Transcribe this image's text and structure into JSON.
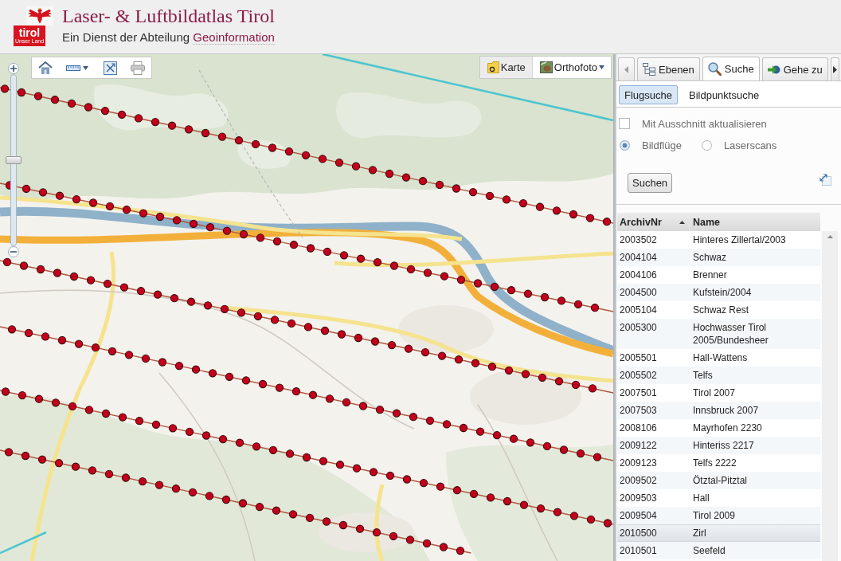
{
  "header": {
    "logo": {
      "wordmark": "tirol",
      "tagline": "Unser Land"
    },
    "title": "Laser- & Luftbildatlas Tirol",
    "subtitle": "Ein Dienst der Abteilung",
    "subtitle_link": "Geoinformation"
  },
  "map": {
    "zoom_slider": {
      "level": 0.5
    },
    "basemaps": [
      {
        "label": "Karte",
        "selected": true,
        "has_menu": false
      },
      {
        "label": "Orthofoto",
        "selected": false,
        "has_menu": true
      }
    ]
  },
  "panel": {
    "tabs": [
      {
        "label": "Ebenen",
        "selected": false
      },
      {
        "label": "Suche",
        "selected": true
      },
      {
        "label": "Gehe zu",
        "selected": false
      }
    ],
    "subtabs": [
      {
        "label": "Flugsuche",
        "selected": true
      },
      {
        "label": "Bildpunktsuche",
        "selected": false
      }
    ],
    "update_with_extent": {
      "label": "Mit Ausschnitt aktualisieren",
      "checked": false
    },
    "source_options": [
      {
        "label": "Bildflüge",
        "selected": true
      },
      {
        "label": "Laserscans",
        "selected": false
      }
    ],
    "search_button": "Suchen",
    "table": {
      "columns": [
        {
          "label": "ArchivNr",
          "sorted": true
        },
        {
          "label": "Name",
          "sorted": false
        }
      ],
      "rows": [
        {
          "archiv_nr": "2003502",
          "name": "Hinteres Zillertal/2003",
          "selected": false
        },
        {
          "archiv_nr": "2004104",
          "name": "Schwaz",
          "selected": false
        },
        {
          "archiv_nr": "2004106",
          "name": "Brenner",
          "selected": false
        },
        {
          "archiv_nr": "2004500",
          "name": "Kufstein/2004",
          "selected": false
        },
        {
          "archiv_nr": "2005104",
          "name": "Schwaz Rest",
          "selected": false
        },
        {
          "archiv_nr": "2005300",
          "name": "Hochwasser Tirol 2005/Bundesheer",
          "selected": false
        },
        {
          "archiv_nr": "2005501",
          "name": "Hall-Wattens",
          "selected": false
        },
        {
          "archiv_nr": "2005502",
          "name": "Telfs",
          "selected": false
        },
        {
          "archiv_nr": "2007501",
          "name": "Tirol 2007",
          "selected": false
        },
        {
          "archiv_nr": "2007503",
          "name": "Innsbruck 2007",
          "selected": false
        },
        {
          "archiv_nr": "2008106",
          "name": "Mayrhofen 2230",
          "selected": false
        },
        {
          "archiv_nr": "2009122",
          "name": "Hinteriss 2217",
          "selected": false
        },
        {
          "archiv_nr": "2009123",
          "name": "Telfs 2222",
          "selected": false
        },
        {
          "archiv_nr": "2009502",
          "name": "Ötztal-Pitztal",
          "selected": false
        },
        {
          "archiv_nr": "2009503",
          "name": "Hall",
          "selected": false
        },
        {
          "archiv_nr": "2009504",
          "name": "Tirol 2009",
          "selected": false
        },
        {
          "archiv_nr": "2010500",
          "name": "Zirl",
          "selected": true
        },
        {
          "archiv_nr": "2010501",
          "name": "Seefeld",
          "selected": false
        }
      ]
    }
  }
}
